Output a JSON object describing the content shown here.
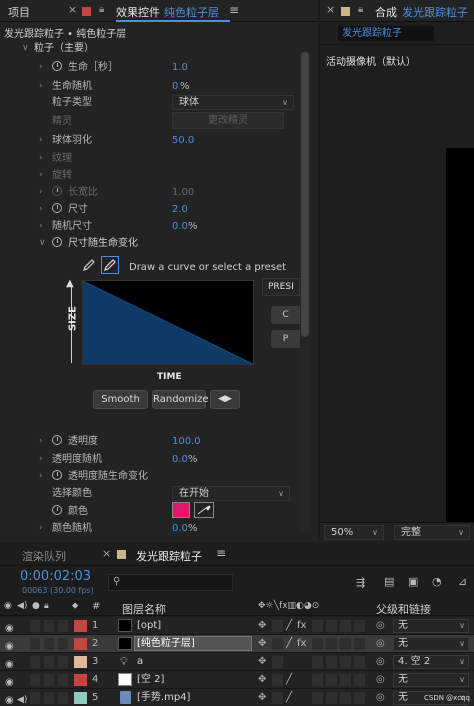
{
  "project_tab": {
    "label": "项目"
  },
  "effects_tab": {
    "label": "效果控件",
    "layer": "纯色粒子层"
  },
  "comp_tab": {
    "label": "合成",
    "name": "发光跟踪粒子"
  },
  "breadcrumb": "发光跟踪粒子 • 纯色粒子层",
  "section": {
    "label": "粒子（主要）"
  },
  "props": {
    "life_label": "生命［秒］",
    "life_value": "1.0",
    "life_rand_label": "生命随机",
    "life_rand_value": "0",
    "life_rand_unit": "%",
    "ptype_label": "粒子类型",
    "ptype_value": "球体",
    "sphere_label": "精灵",
    "sphere_btn": "更改精灵",
    "feather_label": "球体羽化",
    "feather_value": "50.0",
    "texture_label": "纹理",
    "rotate_label": "旋转",
    "aspect_label": "长宽比",
    "aspect_value": "1.00",
    "size_label": "尺寸",
    "size_value": "2.0",
    "size_rand_label": "随机尺寸",
    "size_rand_value": "0.0",
    "size_rand_unit": "%",
    "size_over_life_label": "尺寸随生命变化",
    "opacity_label": "透明度",
    "opacity_value": "100.0",
    "opacity_rand_label": "透明度随机",
    "opacity_rand_value": "0.0",
    "opacity_rand_unit": "%",
    "opacity_over_life_label": "透明度随生命变化",
    "choose_color_label": "选择颜色",
    "choose_color_value": "在开始",
    "color_label": "颜色",
    "color_rand_label": "颜色随机",
    "color_rand_value": "0.0",
    "color_rand_unit": "%"
  },
  "graph": {
    "hint": "Draw a curve or select a preset",
    "y_label": "SIZE",
    "x_label": "TIME",
    "preset_label": "PRESI",
    "smooth_btn": "Smooth",
    "randomize_btn": "Randomize",
    "side_btn_1": "C",
    "side_btn_2": "P"
  },
  "viewer": {
    "camera": "活动摄像机（默认）",
    "zoom": "50%",
    "quality": "完整"
  },
  "timeline": {
    "render_queue_tab": "渲染队列",
    "comp_tab": "发光跟踪粒子",
    "timecode": "0:00:02:03",
    "frame_info": "00063 (30.00 fps)",
    "search_placeholder": "",
    "col_num": "#",
    "col_layer_name": "图层名称",
    "col_parent": "父级和链接",
    "layers": [
      {
        "num": "1",
        "name": "[opt]",
        "parent": "无",
        "label_color": "#c8443f"
      },
      {
        "num": "2",
        "name": "[纯色粒子层]",
        "parent": "无",
        "label_color": "#c8443f"
      },
      {
        "num": "3",
        "name": "a",
        "parent": "4. 空 2",
        "label_color": "#e0b89a"
      },
      {
        "num": "4",
        "name": "[空 2]",
        "parent": "无",
        "label_color": "#c8443f"
      },
      {
        "num": "5",
        "name": "[手势.mp4]",
        "parent": "无",
        "label_color": "#8fc9c4"
      }
    ]
  },
  "watermark": "CSDN @xcqq",
  "colors": {
    "accent": "#4a90e2",
    "particle_color": "#e0186d",
    "graph_fill": "#0f3a66"
  }
}
